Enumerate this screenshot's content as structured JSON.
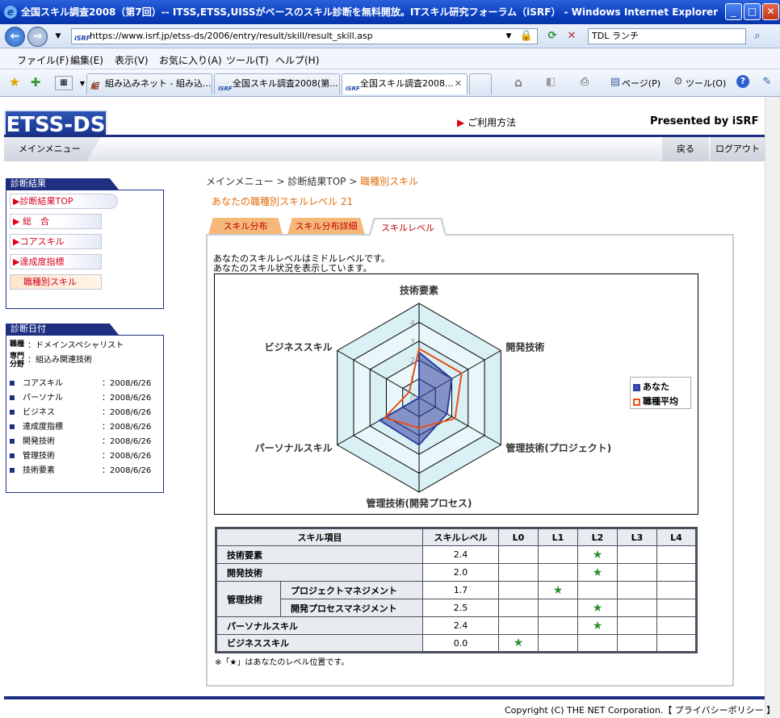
{
  "window": {
    "title": "全国スキル調査2008（第7回）-- ITSS,ETSS,UISSがベースのスキル診断を無料開放。ITスキル研究フォーラム（iSRF） - Windows Internet Explorer"
  },
  "browser": {
    "url": "https://www.isrf.jp/etss-ds/2006/entry/result/skill/result_skill.asp",
    "search_value": "TDL ランチ",
    "menu": [
      "ファイル(F)",
      "編集(E)",
      "表示(V)",
      "お気に入り(A)",
      "ツール(T)",
      "ヘルプ(H)"
    ],
    "tabs": [
      {
        "label": "組み込みネット - 組み込...",
        "icon": "組"
      },
      {
        "label": "全国スキル調査2008(第...",
        "icon": "iSRF"
      },
      {
        "label": "全国スキル調査2008...",
        "icon": "iSRF"
      }
    ],
    "tools": {
      "page": "ページ(P)",
      "tool": "ツール(O)"
    }
  },
  "site": {
    "logo": "ETSS-DS",
    "guide_link": "ご利用方法",
    "presented": "Presented by iSRF",
    "main_menu": "メインメニュー",
    "back": "戻る",
    "logout": "ログアウト"
  },
  "sidebar": {
    "result_header": "診断結果",
    "result_items": [
      "診断結果TOP",
      "総　合",
      "コアスキル",
      "達成度指標",
      "職種別スキル"
    ],
    "date_header": "診断日付",
    "job_label": "職種",
    "job_value": "：ドメインスペシャリスト",
    "field_label1": "専門",
    "field_label2": "分野",
    "field_value": "：組込み関連技術",
    "dates": [
      {
        "label": "コアスキル",
        "date": "：2008/6/26"
      },
      {
        "label": "パーソナル",
        "date": "：2008/6/26"
      },
      {
        "label": "ビジネス",
        "date": "：2008/6/26"
      },
      {
        "label": "達成度指標",
        "date": "：2008/6/26"
      },
      {
        "label": "開発技術",
        "date": "：2008/6/26"
      },
      {
        "label": "管理技術",
        "date": "：2008/6/26"
      },
      {
        "label": "技術要素",
        "date": "：2008/6/26"
      }
    ]
  },
  "main": {
    "breadcrumb": {
      "c1": "メインメニュー",
      "sep": ">",
      "c2": "診断結果TOP",
      "c3": "職種別スキル"
    },
    "level_text": "あなたの職種別スキルレベル  21",
    "tabs": [
      "スキル分布",
      "スキル分布詳細",
      "スキルレベル"
    ],
    "intro1": "あなたのスキルレベルはミドルレベルです。",
    "intro2": "あなたのスキル状況を表示しています。",
    "note": "※「★」はあなたのレベル位置です。"
  },
  "chart_data": {
    "type": "radar",
    "axes": [
      "技術要素",
      "開発技術",
      "管理技術(プロジェクト)",
      "管理技術(開発プロセス)",
      "パーソナルスキル",
      "ビジネススキル"
    ],
    "ticks": [
      "0",
      "1",
      "2",
      "3",
      "4"
    ],
    "rmax": 5,
    "series": [
      {
        "name": "あなた",
        "values": [
          2.4,
          2.0,
          1.7,
          2.5,
          2.4,
          0.0
        ],
        "color": "#2f3f9e"
      },
      {
        "name": "職種平均",
        "values": [
          2.6,
          2.6,
          2.2,
          1.6,
          2.1,
          0.6
        ],
        "color": "#e8501a"
      }
    ],
    "legend": "right"
  },
  "skill_table": {
    "headers": [
      "スキル項目",
      "スキルレベル",
      "L0",
      "L1",
      "L2",
      "L3",
      "L4"
    ],
    "star": "★",
    "group_label": "管理技術",
    "rows": [
      {
        "label": "技術要素",
        "level": "2.4",
        "star": 2
      },
      {
        "label": "開発技術",
        "level": "2.0",
        "star": 2
      },
      {
        "label": "プロジェクトマネジメント",
        "level": "1.7",
        "star": 1
      },
      {
        "label": "開発プロセスマネジメント",
        "level": "2.5",
        "star": 2
      },
      {
        "label": "パーソナルスキル",
        "level": "2.4",
        "star": 2
      },
      {
        "label": "ビジネススキル",
        "level": "0.0",
        "star": 0
      }
    ]
  },
  "footer": {
    "copyright": "Copyright (C) THE NET Corporation.【 プライバシーポリシー 】"
  }
}
